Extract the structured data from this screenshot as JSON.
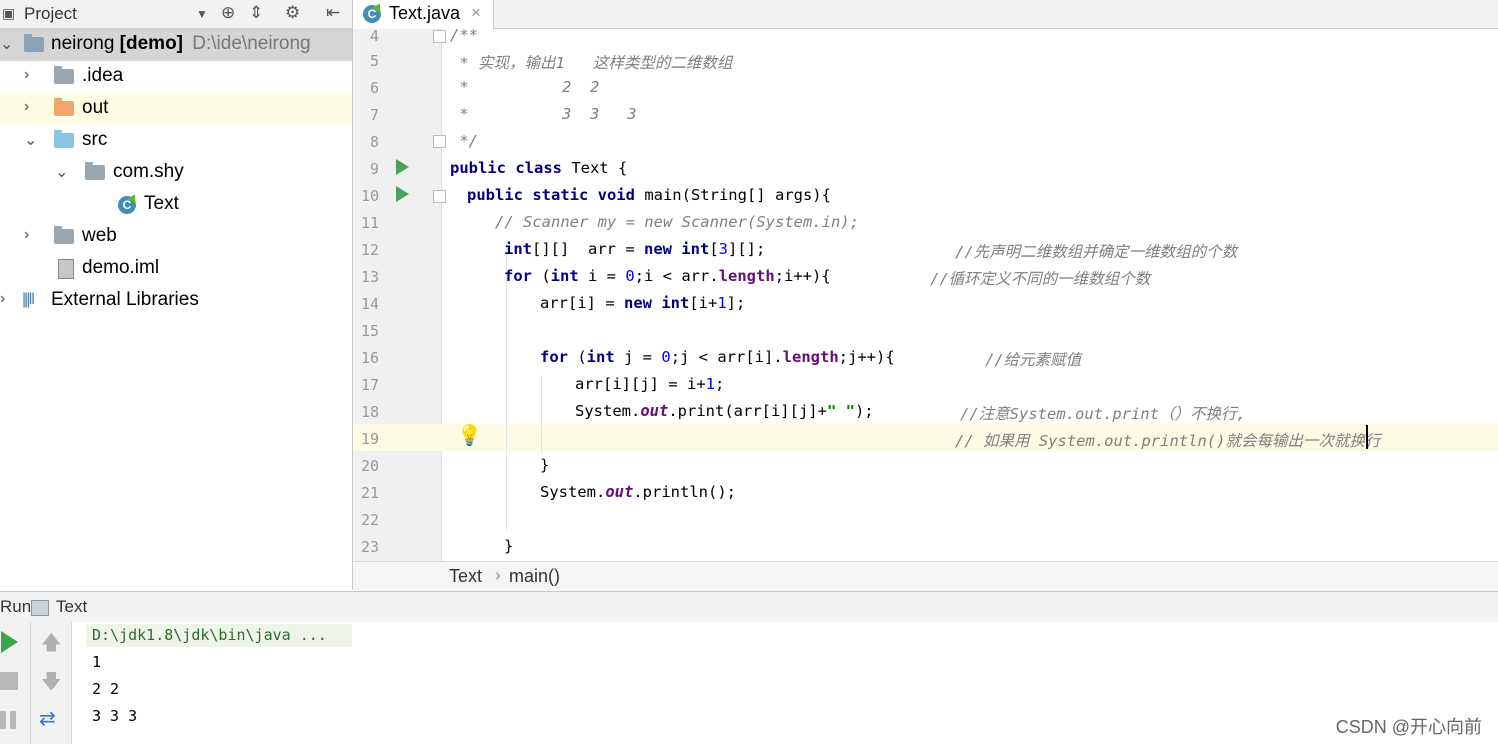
{
  "project_panel": {
    "title": "Project",
    "tree": [
      {
        "label": "neirong",
        "bold_suffix": "[demo]",
        "path": "D:\\ide\\neirong"
      },
      {
        "label": ".idea"
      },
      {
        "label": "out"
      },
      {
        "label": "src"
      },
      {
        "label": "com.shy"
      },
      {
        "label": "Text"
      },
      {
        "label": "web"
      },
      {
        "label": "demo.iml"
      },
      {
        "label": "External Libraries"
      }
    ]
  },
  "editor": {
    "tab_label": "Text.java",
    "tab_close": "×",
    "line_numbers": [
      "4",
      "5",
      "6",
      "7",
      "8",
      "9",
      "10",
      "11",
      "12",
      "13",
      "14",
      "15",
      "16",
      "17",
      "18",
      "19",
      "20",
      "21",
      "22",
      "23"
    ],
    "comment_lines": {
      "l4": "/**",
      "l5": " * 实现，输出1   这样类型的二维数组",
      "l6": " *          2  2",
      "l7": " *          3  3   3",
      "l8": " */",
      "l11": "// Scanner my = new Scanner(System.in);",
      "l12c": "//先声明二维数组并确定一维数组的个数",
      "l13c": "//循环定义不同的一维数组个数",
      "l16c": "//给元素赋值",
      "l18c": "//注意System.out.print（）不换行,",
      "l19c": "// 如果用 System.out.println()就会每输出一次就换行"
    },
    "breadcrumb": {
      "class": "Text",
      "sep": "›",
      "method": "main()"
    }
  },
  "run_panel": {
    "title": "Run",
    "config": "Text",
    "command": "D:\\jdk1.8\\jdk\\bin\\java ...",
    "output": [
      "1",
      "2 2",
      "3 3 3"
    ]
  },
  "watermark": "CSDN @开心向前"
}
